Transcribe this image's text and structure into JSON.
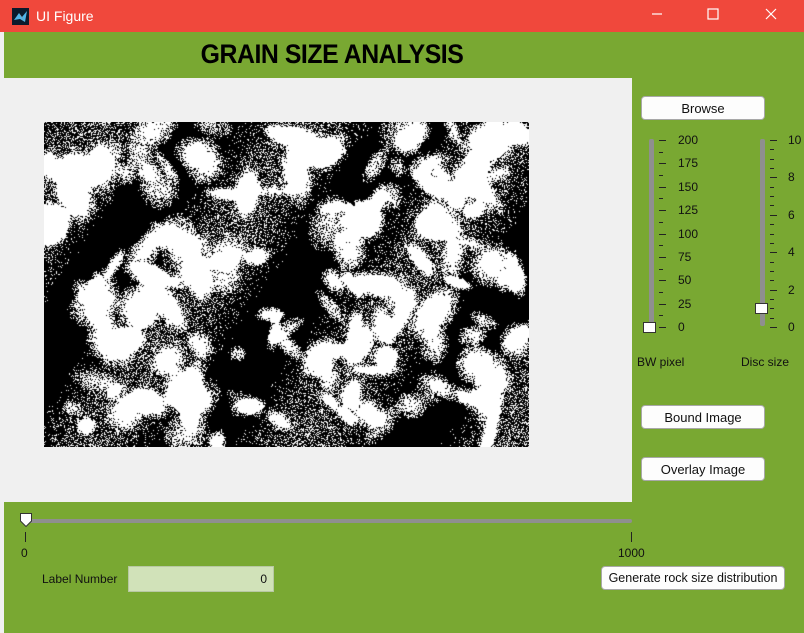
{
  "window": {
    "title": "UI Figure",
    "titlebar_color": "#f0483c",
    "background_color": "#79a832",
    "minimize_icon": "minimize-icon",
    "maximize_icon": "maximize-icon",
    "close_icon": "close-icon"
  },
  "heading": "GRAIN SIZE ANALYSIS",
  "buttons": {
    "browse": "Browse",
    "bound_image": "Bound Image",
    "overlay_image": "Overlay Image",
    "generate": "Generate rock size distribution"
  },
  "bw_slider": {
    "label": "BW pixel",
    "ticks": [
      "200",
      "175",
      "150",
      "125",
      "100",
      "75",
      "50",
      "25",
      "0"
    ],
    "value": 0
  },
  "disc_slider": {
    "label": "Disc size",
    "ticks": [
      "10",
      "8",
      "6",
      "4",
      "2",
      "0"
    ],
    "value": 1
  },
  "label_slider": {
    "min_label": "0",
    "max_label": "1000",
    "value": 0
  },
  "label_number": {
    "label": "Label Number",
    "value": "0"
  },
  "image": {
    "description_icon": "binary-grain-image"
  }
}
